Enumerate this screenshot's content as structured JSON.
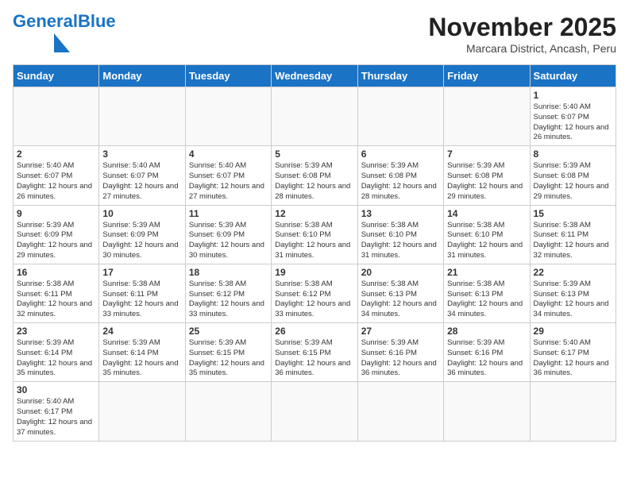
{
  "header": {
    "logo_general": "General",
    "logo_blue": "Blue",
    "month_title": "November 2025",
    "subtitle": "Marcara District, Ancash, Peru"
  },
  "weekdays": [
    "Sunday",
    "Monday",
    "Tuesday",
    "Wednesday",
    "Thursday",
    "Friday",
    "Saturday"
  ],
  "weeks": [
    [
      {
        "day": "",
        "info": ""
      },
      {
        "day": "",
        "info": ""
      },
      {
        "day": "",
        "info": ""
      },
      {
        "day": "",
        "info": ""
      },
      {
        "day": "",
        "info": ""
      },
      {
        "day": "",
        "info": ""
      },
      {
        "day": "1",
        "info": "Sunrise: 5:40 AM\nSunset: 6:07 PM\nDaylight: 12 hours and 26 minutes."
      }
    ],
    [
      {
        "day": "2",
        "info": "Sunrise: 5:40 AM\nSunset: 6:07 PM\nDaylight: 12 hours and 26 minutes."
      },
      {
        "day": "3",
        "info": "Sunrise: 5:40 AM\nSunset: 6:07 PM\nDaylight: 12 hours and 27 minutes."
      },
      {
        "day": "4",
        "info": "Sunrise: 5:40 AM\nSunset: 6:07 PM\nDaylight: 12 hours and 27 minutes."
      },
      {
        "day": "5",
        "info": "Sunrise: 5:39 AM\nSunset: 6:08 PM\nDaylight: 12 hours and 28 minutes."
      },
      {
        "day": "6",
        "info": "Sunrise: 5:39 AM\nSunset: 6:08 PM\nDaylight: 12 hours and 28 minutes."
      },
      {
        "day": "7",
        "info": "Sunrise: 5:39 AM\nSunset: 6:08 PM\nDaylight: 12 hours and 29 minutes."
      },
      {
        "day": "8",
        "info": "Sunrise: 5:39 AM\nSunset: 6:08 PM\nDaylight: 12 hours and 29 minutes."
      }
    ],
    [
      {
        "day": "9",
        "info": "Sunrise: 5:39 AM\nSunset: 6:09 PM\nDaylight: 12 hours and 29 minutes."
      },
      {
        "day": "10",
        "info": "Sunrise: 5:39 AM\nSunset: 6:09 PM\nDaylight: 12 hours and 30 minutes."
      },
      {
        "day": "11",
        "info": "Sunrise: 5:39 AM\nSunset: 6:09 PM\nDaylight: 12 hours and 30 minutes."
      },
      {
        "day": "12",
        "info": "Sunrise: 5:38 AM\nSunset: 6:10 PM\nDaylight: 12 hours and 31 minutes."
      },
      {
        "day": "13",
        "info": "Sunrise: 5:38 AM\nSunset: 6:10 PM\nDaylight: 12 hours and 31 minutes."
      },
      {
        "day": "14",
        "info": "Sunrise: 5:38 AM\nSunset: 6:10 PM\nDaylight: 12 hours and 31 minutes."
      },
      {
        "day": "15",
        "info": "Sunrise: 5:38 AM\nSunset: 6:11 PM\nDaylight: 12 hours and 32 minutes."
      }
    ],
    [
      {
        "day": "16",
        "info": "Sunrise: 5:38 AM\nSunset: 6:11 PM\nDaylight: 12 hours and 32 minutes."
      },
      {
        "day": "17",
        "info": "Sunrise: 5:38 AM\nSunset: 6:11 PM\nDaylight: 12 hours and 33 minutes."
      },
      {
        "day": "18",
        "info": "Sunrise: 5:38 AM\nSunset: 6:12 PM\nDaylight: 12 hours and 33 minutes."
      },
      {
        "day": "19",
        "info": "Sunrise: 5:38 AM\nSunset: 6:12 PM\nDaylight: 12 hours and 33 minutes."
      },
      {
        "day": "20",
        "info": "Sunrise: 5:38 AM\nSunset: 6:13 PM\nDaylight: 12 hours and 34 minutes."
      },
      {
        "day": "21",
        "info": "Sunrise: 5:38 AM\nSunset: 6:13 PM\nDaylight: 12 hours and 34 minutes."
      },
      {
        "day": "22",
        "info": "Sunrise: 5:39 AM\nSunset: 6:13 PM\nDaylight: 12 hours and 34 minutes."
      }
    ],
    [
      {
        "day": "23",
        "info": "Sunrise: 5:39 AM\nSunset: 6:14 PM\nDaylight: 12 hours and 35 minutes."
      },
      {
        "day": "24",
        "info": "Sunrise: 5:39 AM\nSunset: 6:14 PM\nDaylight: 12 hours and 35 minutes."
      },
      {
        "day": "25",
        "info": "Sunrise: 5:39 AM\nSunset: 6:15 PM\nDaylight: 12 hours and 35 minutes."
      },
      {
        "day": "26",
        "info": "Sunrise: 5:39 AM\nSunset: 6:15 PM\nDaylight: 12 hours and 36 minutes."
      },
      {
        "day": "27",
        "info": "Sunrise: 5:39 AM\nSunset: 6:16 PM\nDaylight: 12 hours and 36 minutes."
      },
      {
        "day": "28",
        "info": "Sunrise: 5:39 AM\nSunset: 6:16 PM\nDaylight: 12 hours and 36 minutes."
      },
      {
        "day": "29",
        "info": "Sunrise: 5:40 AM\nSunset: 6:17 PM\nDaylight: 12 hours and 36 minutes."
      }
    ],
    [
      {
        "day": "30",
        "info": "Sunrise: 5:40 AM\nSunset: 6:17 PM\nDaylight: 12 hours and 37 minutes."
      },
      {
        "day": "",
        "info": ""
      },
      {
        "day": "",
        "info": ""
      },
      {
        "day": "",
        "info": ""
      },
      {
        "day": "",
        "info": ""
      },
      {
        "day": "",
        "info": ""
      },
      {
        "day": "",
        "info": ""
      }
    ]
  ]
}
